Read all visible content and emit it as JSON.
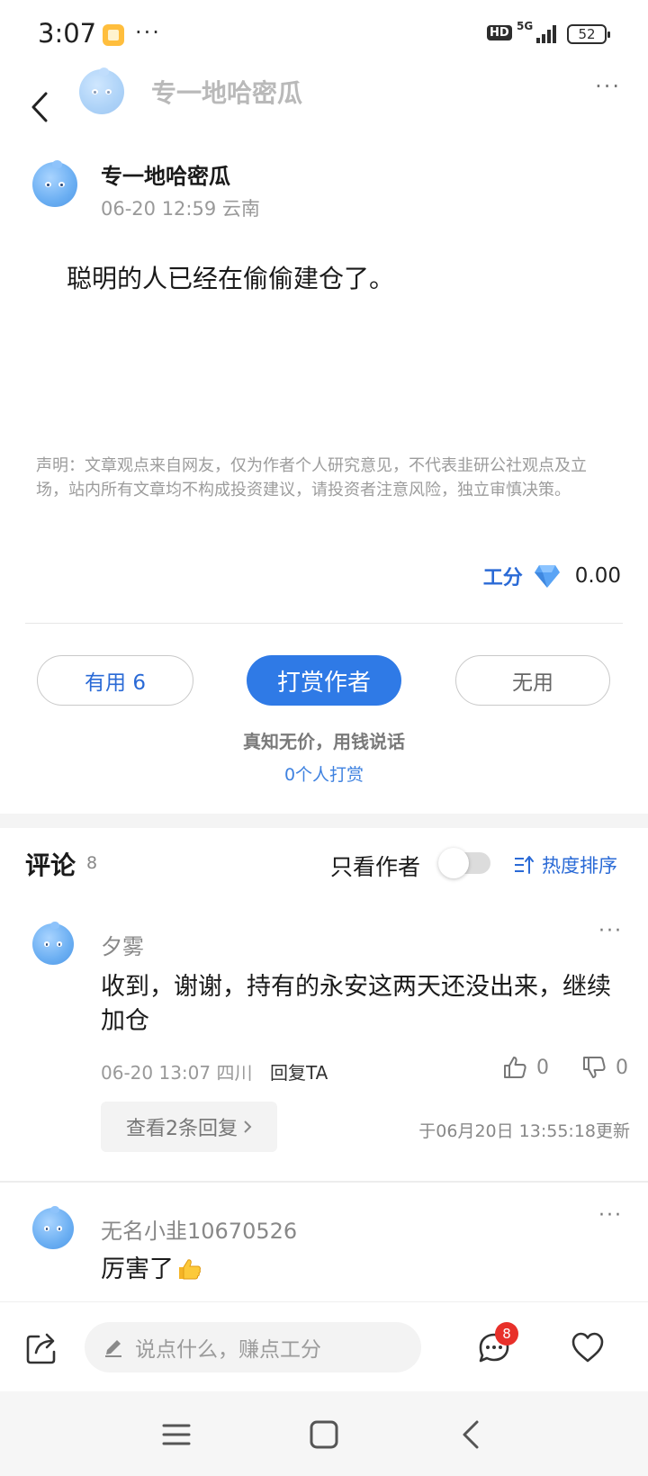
{
  "status_bar": {
    "time": "3:07",
    "more": "···",
    "hd": "HD",
    "network": "5G",
    "battery": "52"
  },
  "header": {
    "title": "专一地哈密瓜",
    "menu": "···"
  },
  "post": {
    "author": "专一地哈密瓜",
    "meta": "06-20 12:59 云南",
    "body": "聪明的人已经在偷偷建仓了。",
    "disclaimer": "声明：文章观点来自网友，仅为作者个人研究意见，不代表韭研公社观点及立场，站内所有文章均不构成投资建议，请投资者注意风险，独立审慎决策。",
    "points_label": "工分",
    "points_value": "0.00"
  },
  "actions": {
    "useful_label": "有用 6",
    "tip_label": "打赏作者",
    "useless_label": "无用",
    "slogan": "真知无价，用钱说话",
    "tippers": "0个人打赏"
  },
  "comments": {
    "title": "评论",
    "count": "8",
    "only_author": "只看作者",
    "sort_label": "热度排序",
    "items": [
      {
        "user": "夕雾",
        "text": "收到，谢谢，持有的永安这两天还没出来，继续加仓",
        "meta": "06-20 13:07 四川",
        "reply": "回复TA",
        "likes": "0",
        "dislikes": "0",
        "view_replies": "查看2条回复",
        "updated": "于06月20日 13:55:18更新",
        "more": "···"
      },
      {
        "user": "无名小韭10670526",
        "text": "厉害了",
        "emoji": "thumbs-up-emoji",
        "more": "···"
      }
    ]
  },
  "bottom_bar": {
    "input_placeholder": "说点什么，赚点工分",
    "comment_badge": "8"
  },
  "colors": {
    "accent": "#2f7ae6",
    "badge": "#e8302a"
  }
}
